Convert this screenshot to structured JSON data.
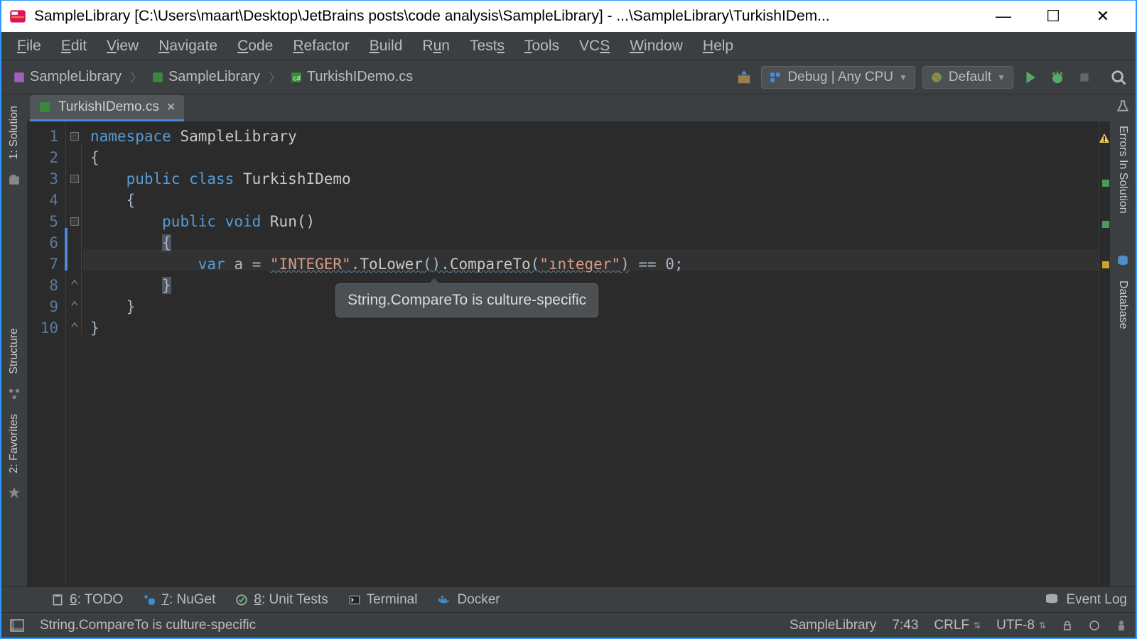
{
  "window": {
    "title": "SampleLibrary [C:\\Users\\maart\\Desktop\\JetBrains posts\\code analysis\\SampleLibrary] - ...\\SampleLibrary\\TurkishIDem..."
  },
  "menus": [
    "File",
    "Edit",
    "View",
    "Navigate",
    "Code",
    "Refactor",
    "Build",
    "Run",
    "Tests",
    "Tools",
    "VCS",
    "Window",
    "Help"
  ],
  "breadcrumb": {
    "root": "SampleLibrary",
    "project": "SampleLibrary",
    "file": "TurkishIDemo.cs"
  },
  "toolbar": {
    "config": "Debug | Any CPU",
    "run_profile": "Default"
  },
  "tab": {
    "name": "TurkishIDemo.cs"
  },
  "code": {
    "line1_ns": "namespace",
    "line1_name": "SampleLibrary",
    "line3_pub": "public",
    "line3_class": "class",
    "line3_name": "TurkishIDemo",
    "line5_pub": "public",
    "line5_void": "void",
    "line5_name": "Run()",
    "line7_var": "var",
    "line7_a": "a =",
    "line7_str1": "\"INTEGER\"",
    "line7_dot1": ".",
    "line7_m1": "ToLower",
    "line7_p1": "().",
    "line7_m2": "CompareTo",
    "line7_p2": "(",
    "line7_str2": "\"ınteger\"",
    "line7_p3": ")",
    "line7_rest": " == 0;"
  },
  "tooltip": "String.CompareTo is culture-specific",
  "bottom": {
    "todo": "6: TODO",
    "nuget": "7: NuGet",
    "unittests": "8: Unit Tests",
    "terminal": "Terminal",
    "docker": "Docker",
    "eventlog": "Event Log"
  },
  "status": {
    "message": "String.CompareTo is culture-specific",
    "context": "SampleLibrary",
    "caret": "7:43",
    "lineend": "CRLF",
    "encoding": "UTF-8"
  },
  "sidebars": {
    "solution": "1: Solution",
    "structure": "Structure",
    "favorites": "2: Favorites",
    "errors": "Errors In Solution",
    "database": "Database"
  }
}
